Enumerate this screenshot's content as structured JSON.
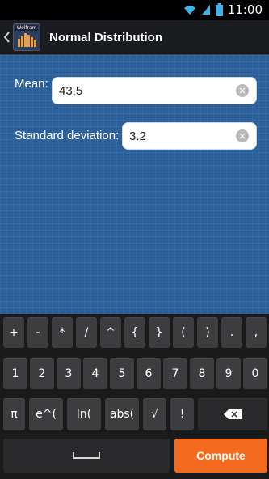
{
  "status": {
    "time": "11:00",
    "icons": [
      "wifi-icon",
      "signal-icon",
      "battery-icon"
    ]
  },
  "app": {
    "title": "Normal Distribution",
    "icon_label": "Wolfram"
  },
  "form": {
    "mean": {
      "label": "Mean:",
      "value": "43.5"
    },
    "stddev": {
      "label": "Standard deviation:",
      "value": "3.2"
    }
  },
  "keyboard": {
    "row1": [
      "+",
      "-",
      "*",
      "/",
      "^",
      "{",
      "}",
      "(",
      ")",
      ".",
      ","
    ],
    "row2": [
      "1",
      "2",
      "3",
      "4",
      "5",
      "6",
      "7",
      "8",
      "9",
      "0"
    ],
    "row3": [
      "π",
      "e^(",
      "ln(",
      "abs(",
      "√",
      "!"
    ],
    "compute_label": "Compute"
  },
  "colors": {
    "accent": "#f46a1e",
    "background": "#2b5f99"
  }
}
